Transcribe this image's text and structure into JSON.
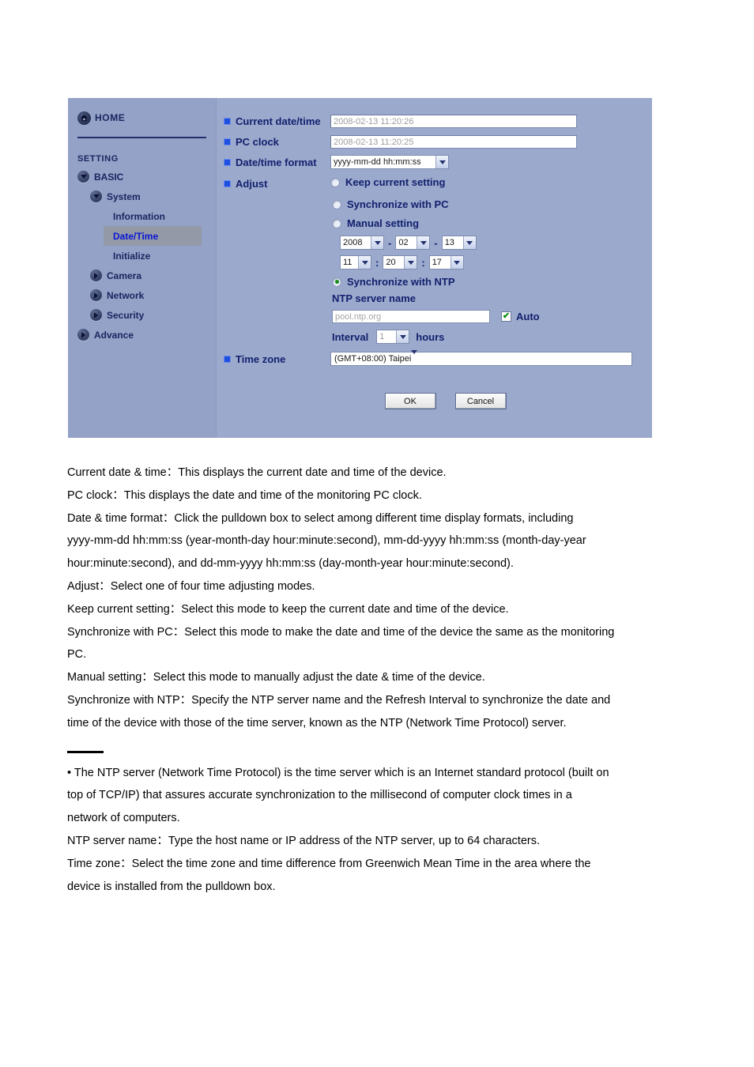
{
  "panel": {
    "sidebar": {
      "home": {
        "label": "HOME",
        "icon": "home-icon"
      },
      "section_label": "SETTING",
      "tree": [
        {
          "label": "BASIC",
          "level": 1,
          "state": "expanded"
        },
        {
          "label": "System",
          "level": 2,
          "state": "expanded"
        },
        {
          "label": "Information",
          "level": 3,
          "state": "leaf",
          "selected": false
        },
        {
          "label": "Date/Time",
          "level": 3,
          "state": "leaf",
          "selected": true
        },
        {
          "label": "Initialize",
          "level": 3,
          "state": "leaf",
          "selected": false
        },
        {
          "label": "Camera",
          "level": 2,
          "state": "collapsed"
        },
        {
          "label": "Network",
          "level": 2,
          "state": "collapsed"
        },
        {
          "label": "Security",
          "level": 2,
          "state": "collapsed"
        },
        {
          "label": "Advance",
          "level": 1,
          "state": "collapsed"
        }
      ]
    },
    "form": {
      "current_datetime": {
        "label": "Current date/time",
        "value": "2008-02-13  11:20:26"
      },
      "pc_clock": {
        "label": "PC clock",
        "value": "2008-02-13  11:20:25"
      },
      "datetime_format": {
        "label": "Date/time format",
        "value": "yyyy-mm-dd hh:mm:ss"
      },
      "adjust": {
        "label": "Adjust",
        "options": [
          {
            "label": "Keep current setting",
            "selected": false
          },
          {
            "label": "Synchronize with PC",
            "selected": false
          },
          {
            "label": "Manual setting",
            "selected": false
          },
          {
            "label": "Synchronize with NTP",
            "selected": true
          }
        ]
      },
      "manual": {
        "year": "2008",
        "month": "02",
        "day": "13",
        "hour": "11",
        "minute": "20",
        "second": "17",
        "date_sep": "-",
        "time_sep": ":"
      },
      "ntp": {
        "server_name_label": "NTP server name",
        "server_placeholder": "pool.ntp.org",
        "auto_label": "Auto",
        "auto_checked": true,
        "auto_check_glyph": "✔",
        "interval_label": "Interval",
        "interval_value": "1",
        "hours_label": "hours"
      },
      "time_zone": {
        "label": "Time zone",
        "value": "(GMT+08:00) Taipei"
      },
      "buttons": {
        "ok": "OK",
        "cancel": "Cancel"
      }
    }
  },
  "document": {
    "paragraphs": [
      "Current date & time：This displays the current date and time of the device.",
      "PC clock：This displays the date and time of the monitoring PC clock.",
      "Date & time format：Click the pulldown box to select among different time display formats, including",
      "yyyy-mm-dd hh:mm:ss (year-month-day hour:minute:second), mm-dd-yyyy hh:mm:ss (month-day-year",
      "hour:minute:second), and dd-mm-yyyy hh:mm:ss (day-month-year hour:minute:second).",
      "Adjust：Select one of four time adjusting modes.",
      "Keep current setting：Select this mode to keep the current date and time of the device.",
      "Synchronize with PC：Select this mode to make the date and time of the device the same as the monitoring",
      "PC.",
      "Manual setting：Select this mode to manually adjust the date & time of the device.",
      "Synchronize with NTP：Specify the NTP server name and the Refresh Interval to synchronize the date and",
      "time of the device with those of the time server, known as the NTP (Network Time Protocol) server."
    ],
    "footnote_paragraphs": [
      "• The NTP server (Network Time Protocol) is the time server which is an Internet standard protocol (built on",
      "top of TCP/IP) that assures accurate synchronization to the millisecond of computer clock times in a",
      "network of computers.",
      "NTP server name：Type the host name or IP address of the NTP server, up to 64 characters.",
      "Time zone：Select the time zone and time difference from Greenwich Mean Time in the area where the",
      "device is installed from the pulldown box."
    ]
  }
}
